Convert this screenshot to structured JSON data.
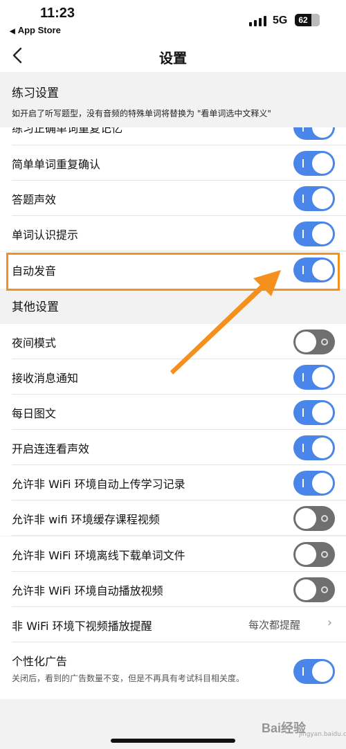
{
  "status_bar": {
    "time": "11:23",
    "back_app": "App Store",
    "network": "5G",
    "battery": "62"
  },
  "nav": {
    "title": "设置"
  },
  "practice": {
    "title": "练习设置",
    "note": "如开启了听写题型，没有音频的特殊单词将替换为 \"看单词选中文释义\"",
    "rows": [
      {
        "label": "练习正确单词重复记忆",
        "on": true
      },
      {
        "label": "简单单词重复确认",
        "on": true
      },
      {
        "label": "答题声效",
        "on": true
      },
      {
        "label": "单词认识提示",
        "on": true
      },
      {
        "label": "自动发音",
        "on": true
      }
    ]
  },
  "other": {
    "title": "其他设置",
    "rows": [
      {
        "label": "夜间模式",
        "on": false
      },
      {
        "label": "接收消息通知",
        "on": true
      },
      {
        "label": "每日图文",
        "on": true
      },
      {
        "label": "开启连连看声效",
        "on": true
      },
      {
        "label": "允许非 WiFi 环境自动上传学习记录",
        "on": true
      },
      {
        "label": "允许非 wifi 环境缓存课程视频",
        "on": false
      },
      {
        "label": "允许非 WiFi 环境离线下载单词文件",
        "on": false
      },
      {
        "label": "允许非 WiFi 环境自动播放视频",
        "on": false
      }
    ],
    "video_reminder": {
      "label": "非 WiFi 环境下视频播放提醒",
      "value": "每次都提醒"
    },
    "ads": {
      "label": "个性化广告",
      "subtitle": "关闭后，看到的广告数量不变，但是不再具有考试科目相关度。",
      "on": true
    }
  },
  "colors": {
    "toggle_on": "#4a86ea",
    "toggle_off": "#6f6f6f",
    "highlight": "#f5901e"
  },
  "watermark": {
    "text": "Bai经验",
    "sub": "jingyan.baidu.com"
  }
}
